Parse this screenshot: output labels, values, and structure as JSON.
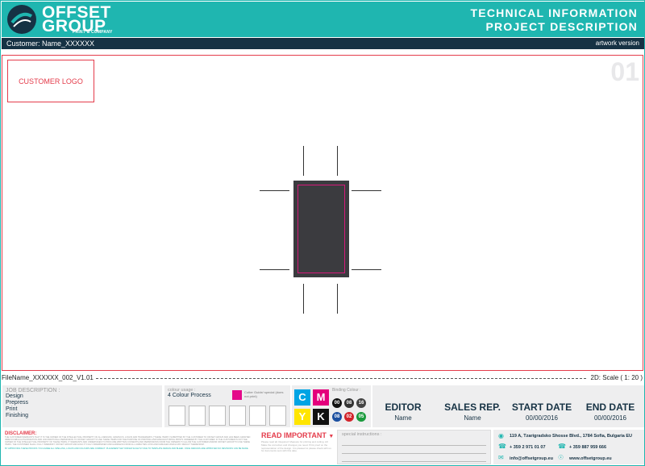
{
  "header": {
    "brand_line1": "OFFSET",
    "brand_line2": "GROUP",
    "brand_sub": "PRINT & COMPANY",
    "title_line1": "TECHNICAL INFORMATION",
    "title_line2": "PROJECT DESCRIPTION",
    "accent_color": "#1fb6b0"
  },
  "customer_bar": {
    "customer": "Customer:  Name_XXXXXX",
    "artwork": "artwork version",
    "bar_color": "#163244"
  },
  "artboard": {
    "customer_logo": "CUSTOMER LOGO",
    "page_number": "01",
    "frame_color": "#e43c4b"
  },
  "file_line": {
    "filename": "FileName_XXXXXX_002_V1.01",
    "scale": "2D: Scale ( 1: 20 )"
  },
  "job_description": {
    "label": "JOB DESCRIPTION :",
    "items": [
      "Design",
      "Prepress",
      "Print",
      "Finishing"
    ]
  },
  "colour_usage": {
    "label": "colour usage :",
    "value": "4 Colour Process",
    "cutter_note": "Cutter Guide/ special (does not print)"
  },
  "cmyk": {
    "c": "C",
    "m": "M",
    "y": "Y",
    "k": "K",
    "binding_label": "Binding Colour :",
    "binding_numbers": [
      "00",
      "08",
      "16",
      "08",
      "02",
      "05"
    ]
  },
  "people": {
    "editor": "EDITOR",
    "editor_name": "Name",
    "sales": "SALES REP.",
    "sales_name": "Name",
    "start": "START DATE",
    "start_value": "00/00/2016",
    "end": "END DATE",
    "end_value": "00/00/2016"
  },
  "disclaimer": {
    "title": "DISCLAIMER:",
    "body": "THE CUSTOMER WARRANTS THAT IT IS THE OWNER OF THE INTELLECTUAL PROPERTY OF ALL DESIGNS, GRAPHICS, LOGOS AND TRADEMARKS (\"THESE ITEMS\") SUBMITTED BY THE CUSTOMER TO OFFSET GROUP AND HAS BEEN GRANTED IRREVOCABLE AUTHORIZATION AND UNCONDITIONAL PERMISSION TO OFFSET GROUP TO USE THESE ITEMS FOR THE PURPOSE OF PRINTING AND MANUFACTURING PRINTS ORDERED BY THE CUSTOMER. IF THE CUSTOMER IS NOT THE OWNER OF THE INTELLECTUAL PROPERTY OF THESE ITEMS, IT WARRANTS AND UNDERTAKES TO PROCURE WRITTEN CONSENTS AND PERMISSIONS FROM THE OWNERS TO ALLOW THE CUSTOMER AND/OR OFFSET GROUP TO USE THESE ITEMS. THE CUSTOMER SHALL FULLY INDEMNIFY OFFSET GROUP AND HOLD IT FULLY INDEMNIFIED AND HARMLESS FROM ALL LIABILITIES LOSS AND DAMAGES WHICH MAY RESULT THEREFROM.",
    "approve": "BY APPROVING THESE PROOFS YOU AGREE ALL SPELLING, LOGOS AND COLOURS ARE CORRECT. PLACEMENT MAY DIFFER SLIGHTLY DUE TO TEMPLATE DESIGN AND BLEED. ONCE DESIGNS ARE APPROVED NO REVISIONS CAN BE MADE."
  },
  "read_important": {
    "title": "READ IMPORTANT",
    "body": "Please read all. Required: Measure for printing and cutting. All: Make the correction and changes you need. Print proof on the representation of the design. It is pleased to please check with us for documents sent with this date."
  },
  "special_instructions": {
    "label": "special instructions :"
  },
  "contact": {
    "address": "119 A, Tzarigradsko Shosse Blvd., 1784 Sofia, Bulgaria EU",
    "phone1": "+ 359 2 971 01 07",
    "phone2": "+ 359 887 959 666",
    "email": "info@offsetgroup.eu",
    "web": "www.offsetgroup.eu"
  }
}
